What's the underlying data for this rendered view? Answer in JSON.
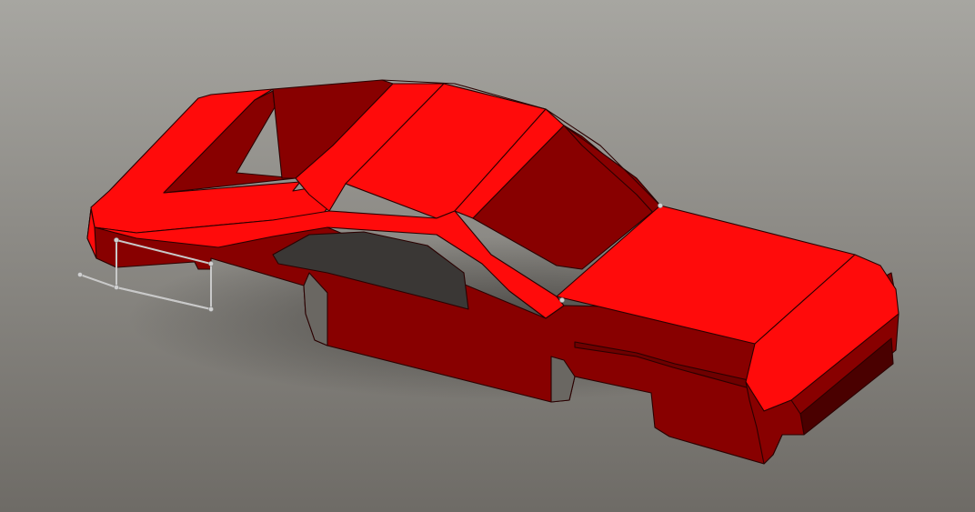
{
  "model": {
    "body_color": "#e00000",
    "top_color": "#ff0b0b",
    "side_color": "#880000",
    "shadow_side_color": "#6e0000",
    "edge_color": "#2a0000",
    "sketch_color": "#c9c9c9"
  }
}
